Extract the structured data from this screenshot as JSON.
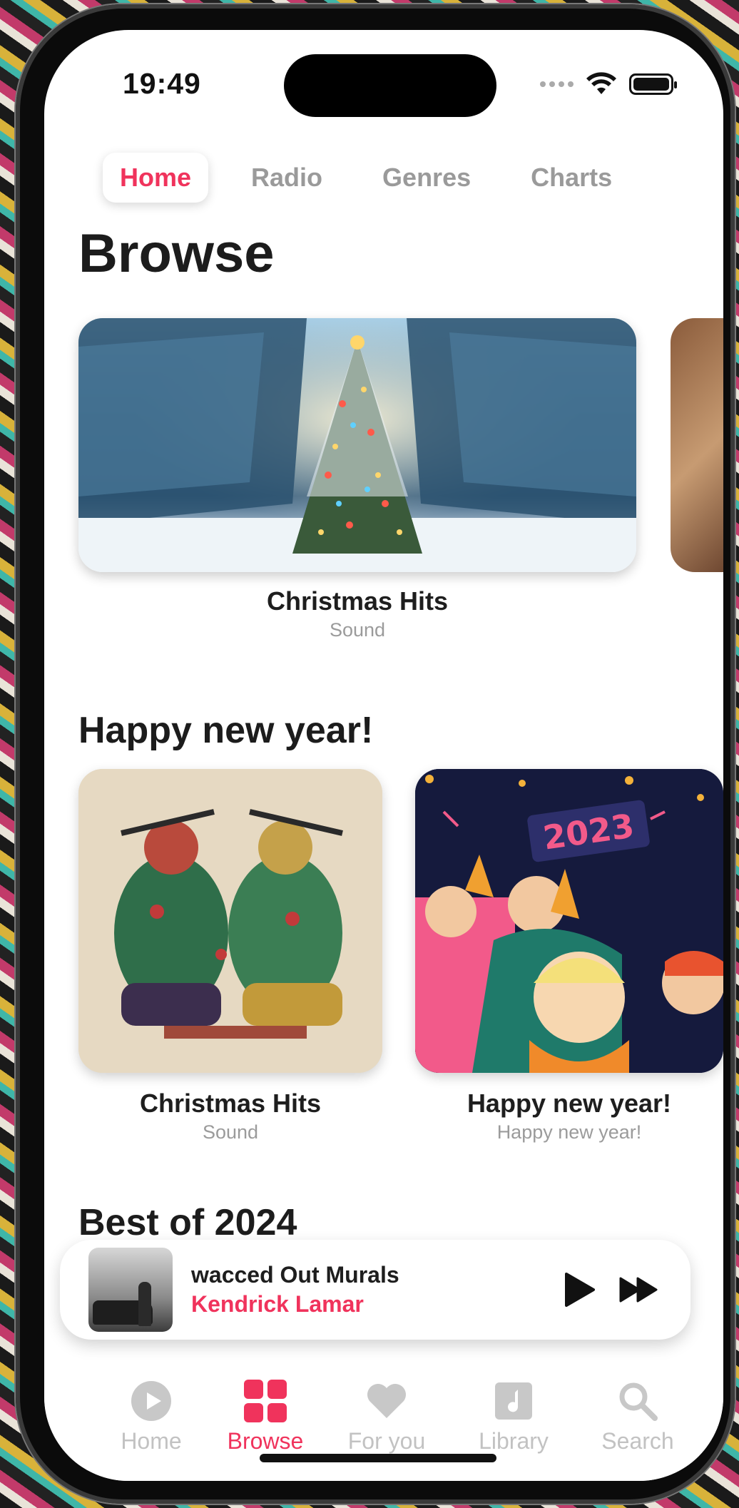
{
  "status_bar": {
    "time": "19:49"
  },
  "top_tabs": [
    {
      "label": "Home",
      "active": true
    },
    {
      "label": "Radio",
      "active": false
    },
    {
      "label": "Genres",
      "active": false
    },
    {
      "label": "Charts",
      "active": false
    }
  ],
  "page_title": "Browse",
  "featured": {
    "title": "Christmas Hits",
    "subtitle": "Sound"
  },
  "sections": [
    {
      "title": "Happy new year!",
      "items": [
        {
          "title": "Christmas Hits",
          "subtitle": "Sound"
        },
        {
          "title": "Happy new year!",
          "subtitle": "Happy new year!",
          "badge": "2023"
        }
      ]
    },
    {
      "title": "Best of 2024"
    }
  ],
  "now_playing": {
    "title": "wacced Out Murals",
    "artist": "Kendrick Lamar"
  },
  "tab_bar": [
    {
      "label": "Home",
      "icon": "play-circle-icon",
      "active": false
    },
    {
      "label": "Browse",
      "icon": "grid-icon",
      "active": true
    },
    {
      "label": "For you",
      "icon": "heart-icon",
      "active": false
    },
    {
      "label": "Library",
      "icon": "music-note-icon",
      "active": false
    },
    {
      "label": "Search",
      "icon": "search-icon",
      "active": false
    }
  ],
  "colors": {
    "accent": "#f0335c",
    "inactive": "#9a9a9a"
  }
}
